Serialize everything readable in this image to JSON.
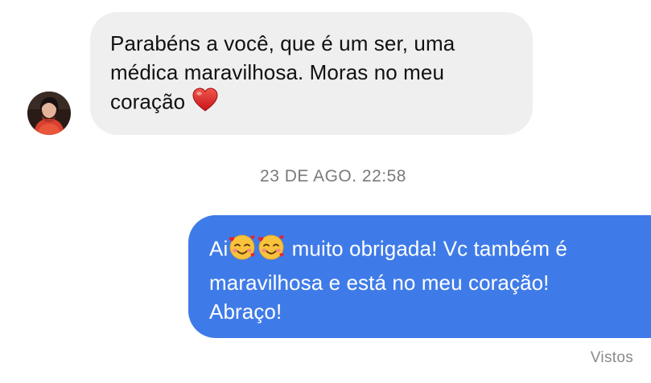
{
  "messages": {
    "incoming": {
      "line1": "Parabéns a você, que é um ser, uma",
      "line2": "médica maravilhosa. Moras no meu",
      "line3": "coração ",
      "emoji": "red-heart"
    },
    "timestamp": "23 DE AGO. 22:58",
    "outgoing": {
      "prefix": "Ai",
      "emoji": "smiling-face-with-hearts",
      "line1_rest": " muito obrigada! Vc também é",
      "line2": "maravilhosa e está no meu coração!",
      "line3": "Abraço!"
    },
    "status": "Vistos"
  },
  "colors": {
    "incoming_bubble": "#efefef",
    "outgoing_bubble": "#3f7be8",
    "timestamp_text": "#7a7a7a"
  }
}
